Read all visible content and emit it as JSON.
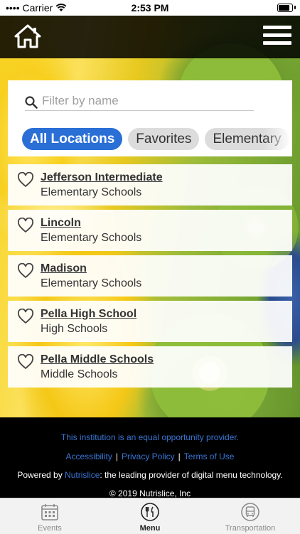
{
  "status_bar": {
    "carrier": "Carrier",
    "time": "2:53 PM"
  },
  "header": {
    "home_icon": "home-icon",
    "menu_icon": "hamburger-menu-icon"
  },
  "filter": {
    "placeholder": "Filter by name",
    "value": "",
    "chips": [
      {
        "label": "All Locations",
        "active": true
      },
      {
        "label": "Favorites",
        "active": false
      },
      {
        "label": "Elementary",
        "active": false
      }
    ]
  },
  "schools": [
    {
      "name": "Jefferson Intermediate",
      "type": "Elementary Schools"
    },
    {
      "name": "Lincoln",
      "type": "Elementary Schools"
    },
    {
      "name": "Madison",
      "type": "Elementary Schools"
    },
    {
      "name": "Pella High School",
      "type": "High Schools"
    },
    {
      "name": "Pella Middle Schools",
      "type": "Middle Schools"
    }
  ],
  "footer": {
    "equal_opportunity": "This institution is an equal opportunity provider.",
    "links": [
      "Accessibility",
      "Privacy Policy",
      "Terms of Use"
    ],
    "separator": "|",
    "powered_prefix": "Powered by ",
    "powered_brand": "Nutrislice",
    "powered_suffix": ": the leading provider of digital menu technology.",
    "copyright": "© 2019 Nutrislice, Inc"
  },
  "tabs": [
    {
      "label": "Events",
      "icon": "calendar-icon",
      "active": false
    },
    {
      "label": "Menu",
      "icon": "fork-knife-icon",
      "active": true
    },
    {
      "label": "Transportation",
      "icon": "bus-icon",
      "active": false
    }
  ],
  "colors": {
    "accent": "#2a6fd6",
    "link": "#3a76d4",
    "header_bg": "#000000"
  }
}
